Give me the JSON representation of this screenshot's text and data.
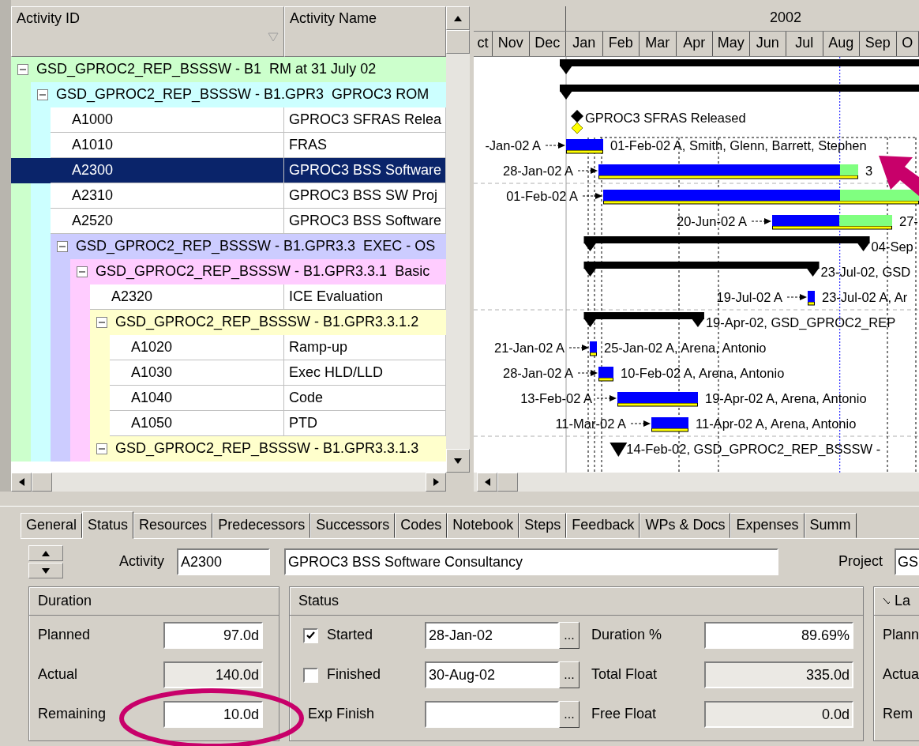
{
  "columns": [
    "Activity ID",
    "Activity Name"
  ],
  "timescale": {
    "year": "2002",
    "months": [
      "ct",
      "Nov",
      "Dec",
      "Jan",
      "Feb",
      "Mar",
      "Apr",
      "May",
      "Jun",
      "Jul",
      "Aug",
      "Sep",
      "O"
    ]
  },
  "activities": [
    {
      "kind": "group",
      "label": "GSD_GPROC2_REP_BSSSW - B1  RM at 31 July 02",
      "color": "#ccffcc",
      "expanded": true,
      "bar": {
        "kind": "summary"
      },
      "children": [
        {
          "kind": "group",
          "label": "GSD_GPROC2_REP_BSSSW - B1.GPR3  GPROC3 ROM",
          "color": "#ccffff",
          "expanded": true,
          "bar": {
            "kind": "summary"
          },
          "children": [
            {
              "kind": "activity",
              "id": "A1000",
              "name": "GPROC3 SFRAS Relea",
              "selected": false,
              "bar": {
                "kind": "milestone",
                "end_label": "GPROC3 SFRAS Released"
              }
            },
            {
              "kind": "activity",
              "id": "A1010",
              "name": "FRAS",
              "selected": false,
              "bar": {
                "kind": "task",
                "level": 1,
                "start_label": "-Jan-02 A",
                "end_label": "01-Feb-02 A, Smith, Glenn, Barrett, Stephen"
              }
            },
            {
              "kind": "activity",
              "id": "A2300",
              "name": "GPROC3 BSS Software",
              "selected": true,
              "bar": {
                "kind": "task",
                "level": 0.93,
                "start_label": "28-Jan-02 A",
                "end_label": "3"
              }
            },
            {
              "kind": "activity",
              "id": "A2310",
              "name": "GPROC3 BSS SW Proj",
              "selected": false,
              "bar": {
                "kind": "task",
                "level": 0.75,
                "start_label": "01-Feb-02 A"
              }
            },
            {
              "kind": "activity",
              "id": "A2520",
              "name": "GPROC3 BSS Software",
              "selected": false,
              "bar": {
                "kind": "task",
                "level": 0.56,
                "start_label": "20-Jun-02 A",
                "end_label": "27-"
              }
            },
            {
              "kind": "group",
              "label": "GSD_GPROC2_REP_BSSSW - B1.GPR3.3  EXEC - OS",
              "color": "#ccccff",
              "expanded": true,
              "bar": {
                "kind": "summary",
                "end_label": "04-Sep"
              },
              "children": [
                {
                  "kind": "group",
                  "label": "GSD_GPROC2_REP_BSSSW - B1.GPR3.3.1  Basic",
                  "color": "#ffccff",
                  "expanded": true,
                  "bar": {
                    "kind": "summary",
                    "end_label": "23-Jul-02, GSD"
                  },
                  "children": [
                    {
                      "kind": "activity",
                      "id": "A2320",
                      "name": "ICE Evaluation",
                      "selected": false,
                      "bar": {
                        "kind": "task",
                        "level": 1,
                        "start_label": "19-Jul-02 A",
                        "end_label": "23-Jul-02 A, Ar"
                      }
                    },
                    {
                      "kind": "group",
                      "label": "GSD_GPROC2_REP_BSSSW - B1.GPR3.3.1.2",
                      "color": "#ffffcc",
                      "expanded": true,
                      "bar": {
                        "kind": "summary",
                        "end_label": "19-Apr-02, GSD_GPROC2_REP"
                      },
                      "children": [
                        {
                          "kind": "activity",
                          "id": "A1020",
                          "name": "Ramp-up",
                          "selected": false,
                          "bar": {
                            "kind": "task",
                            "level": 1,
                            "start_label": "21-Jan-02 A",
                            "end_label": "25-Jan-02 A, Arena, Antonio"
                          }
                        },
                        {
                          "kind": "activity",
                          "id": "A1030",
                          "name": "Exec HLD/LLD",
                          "selected": false,
                          "bar": {
                            "kind": "task",
                            "level": 1,
                            "start_label": "28-Jan-02 A",
                            "end_label": "10-Feb-02 A, Arena, Antonio"
                          }
                        },
                        {
                          "kind": "activity",
                          "id": "A1040",
                          "name": "Code",
                          "selected": false,
                          "bar": {
                            "kind": "task",
                            "level": 1,
                            "start_label": "13-Feb-02 A",
                            "end_label": "19-Apr-02 A, Arena, Antonio"
                          }
                        },
                        {
                          "kind": "activity",
                          "id": "A1050",
                          "name": "PTD",
                          "selected": false,
                          "bar": {
                            "kind": "task",
                            "level": 1,
                            "start_label": "11-Mar-02 A",
                            "end_label": "11-Apr-02 A, Arena, Antonio"
                          }
                        }
                      ]
                    },
                    {
                      "kind": "group",
                      "label": "GSD_GPROC2_REP_BSSSW - B1.GPR3.3.1.3",
                      "color": "#ffffcc",
                      "expanded": true,
                      "bar": {
                        "kind": "summary",
                        "end_label": "14-Feb-02, GSD_GPROC2_REP_BSSSW -"
                      }
                    }
                  ]
                }
              ]
            }
          ]
        }
      ]
    }
  ],
  "tabs": [
    {
      "label": "General",
      "selected": false
    },
    {
      "label": "Status",
      "selected": true
    },
    {
      "label": "Resources",
      "selected": false
    },
    {
      "label": "Predecessors",
      "selected": false
    },
    {
      "label": "Successors",
      "selected": false
    },
    {
      "label": "Codes",
      "selected": false
    },
    {
      "label": "Notebook",
      "selected": false
    },
    {
      "label": "Steps",
      "selected": false
    },
    {
      "label": "Feedback",
      "selected": false
    },
    {
      "label": "WPs & Docs",
      "selected": false
    },
    {
      "label": "Expenses",
      "selected": false
    },
    {
      "label": "Summ",
      "selected": false
    }
  ],
  "activity": {
    "label": "Activity",
    "id": "A2300",
    "name": "GPROC3 BSS Software Consultancy",
    "project_label": "Project",
    "project_value": "GS"
  },
  "duration": {
    "title": "Duration",
    "fields": [
      {
        "label": "Planned",
        "value": "97.0d",
        "readonly": false
      },
      {
        "label": "Actual",
        "value": "140.0d",
        "readonly": true
      },
      {
        "label": "Remaining",
        "value": "10.0d",
        "readonly": false
      }
    ]
  },
  "status": {
    "title": "Status",
    "rows": [
      {
        "kind": "checkbox",
        "label": "Started",
        "checked": true,
        "date": "28-Jan-02",
        "browse": "...",
        "metric_label": "Duration %",
        "metric_value": "89.69%",
        "metric_readonly": false
      },
      {
        "kind": "checkbox",
        "label": "Finished",
        "checked": false,
        "date": "30-Aug-02",
        "browse": "...",
        "metric_label": "Total Float",
        "metric_value": "335.0d",
        "metric_readonly": true
      },
      {
        "kind": "plain",
        "label": "Exp Finish",
        "browse": "...",
        "metric_label": "Free Float",
        "metric_value": "0.0d",
        "metric_readonly": true
      }
    ]
  },
  "third_group": {
    "title": "La",
    "labels": [
      "Plann",
      "Actua",
      "Rem"
    ]
  }
}
